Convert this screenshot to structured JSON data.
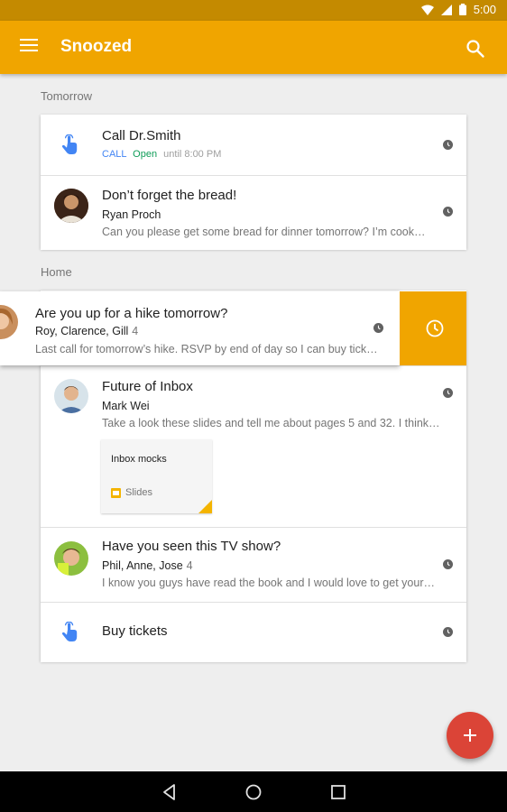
{
  "status": {
    "time": "5:00"
  },
  "appbar": {
    "title": "Snoozed"
  },
  "sections": {
    "tomorrow": "Tomorrow",
    "home": "Home"
  },
  "reminder_call": {
    "title": "Call Dr.Smith",
    "action": "CALL",
    "open": "Open",
    "hours": "until 8:00 PM"
  },
  "bread": {
    "title": "Don’t forget the bread!",
    "sender": "Ryan Proch",
    "snippet": "Can you please get some bread for dinner tomorrow? I’m cook…"
  },
  "hike": {
    "title": "Are you up for a hike tomorrow?",
    "senders": "Roy, Clarence, Gill",
    "count": "4",
    "snippet": "Last call for tomorrow’s hike. RSVP by end of day so I can buy tickets…"
  },
  "inbox": {
    "title": "Future of Inbox",
    "sender": "Mark Wei",
    "snippet": "Take a look these slides and tell me about pages 5 and 32. I think…",
    "attachment_name": "Inbox mocks",
    "attachment_type": "Slides"
  },
  "tvshow": {
    "title": "Have you seen this TV show?",
    "senders": "Phil, Anne, Jose",
    "count": "4",
    "snippet": "I know you guys have read the book and I would love to get your…"
  },
  "tickets": {
    "title": "Buy tickets"
  },
  "colors": {
    "accent": "#f0a500",
    "fab": "#db4437",
    "link_blue": "#4285f4",
    "open_green": "#0f9d58"
  }
}
